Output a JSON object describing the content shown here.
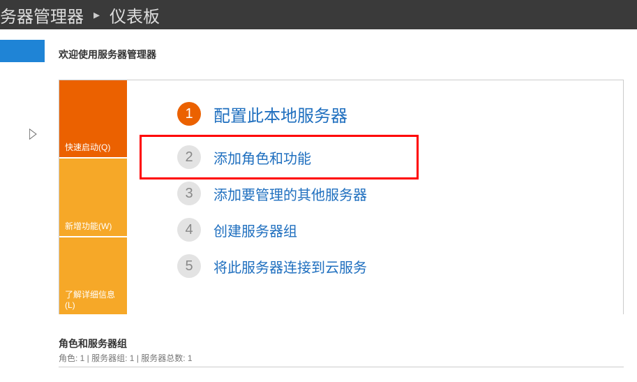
{
  "header": {
    "titlePart1": "务器管理器",
    "separator": "•",
    "titlePart2": "仪表板"
  },
  "welcome": "欢迎使用服务器管理器",
  "sideTabs": {
    "t1": "快速启动(Q)",
    "t2": "新增功能(W)",
    "t3": "了解详细信息(L)"
  },
  "steps": [
    {
      "num": "1",
      "label": "配置此本地服务器"
    },
    {
      "num": "2",
      "label": "添加角色和功能"
    },
    {
      "num": "3",
      "label": "添加要管理的其他服务器"
    },
    {
      "num": "4",
      "label": "创建服务器组"
    },
    {
      "num": "5",
      "label": "将此服务器连接到云服务"
    }
  ],
  "footer": {
    "title": "角色和服务器组",
    "stats": "角色: 1 | 服务器组: 1 | 服务器总数: 1"
  },
  "expandCaret": "▷"
}
